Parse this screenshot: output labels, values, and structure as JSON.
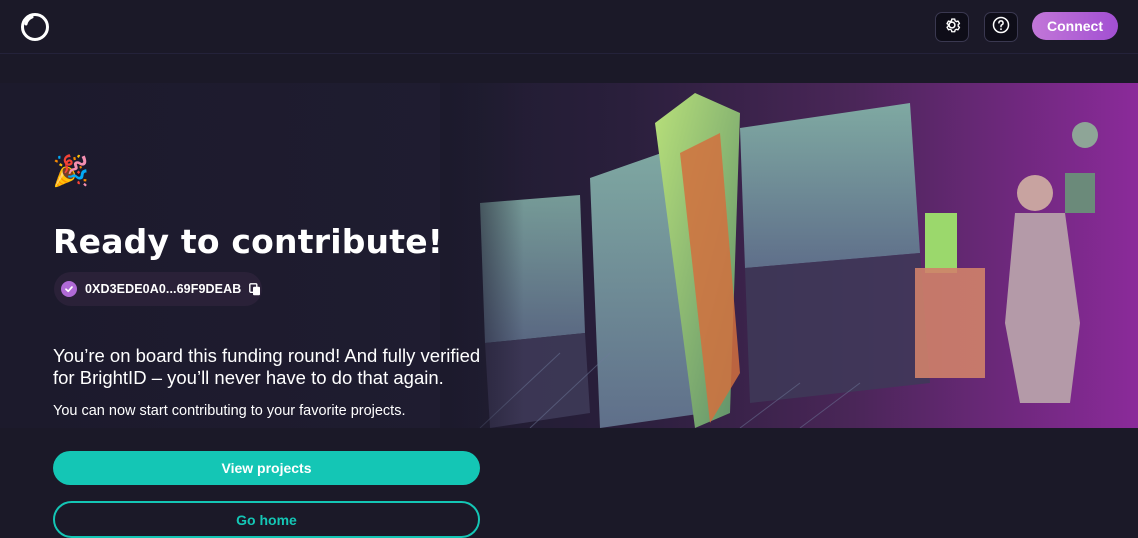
{
  "header": {
    "logo_icon": "ring-logo-icon",
    "settings_icon": "gear-icon",
    "help_icon": "question-circle-icon",
    "connect_label": "Connect"
  },
  "hero": {
    "emoji": "🎉",
    "emoji_icon": "party-popper-icon",
    "title": "Ready to contribute!",
    "address": "0XD3EDE0A0...69F9DEAB",
    "verified_icon": "check-circle-icon",
    "copy_icon": "copy-icon",
    "message": "You’re on board this funding round! And fully verified for BrightID – you’ll never have to do that again.",
    "submessage": "You can now start contributing to your favorite projects."
  },
  "actions": {
    "view_projects_label": "View projects",
    "go_home_label": "Go home"
  },
  "colors": {
    "background": "#1b1928",
    "accent_teal": "#14c6b5",
    "accent_purple": "#b06ad6",
    "banner_magenta": "#8b2a9a"
  }
}
